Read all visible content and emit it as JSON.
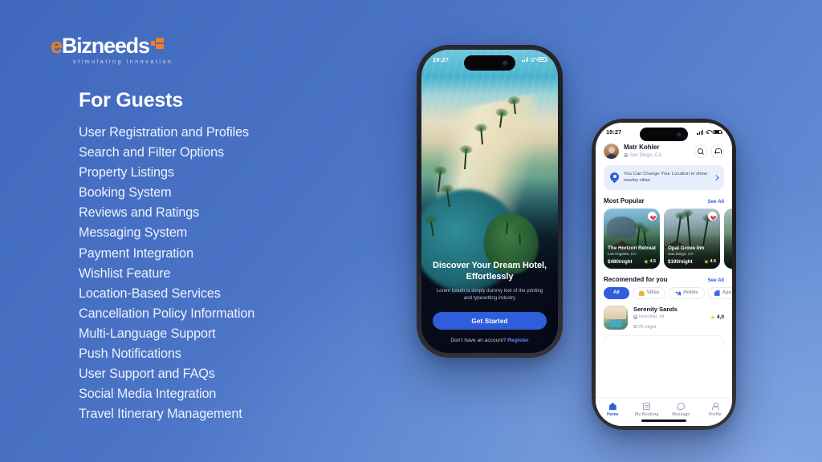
{
  "brand": {
    "name_prefix": "e",
    "name_rest": "Bizneeds",
    "tagline": "stimulating innovation"
  },
  "left_panel": {
    "heading": "For Guests",
    "features": [
      "User Registration and Profiles",
      "Search and Filter Options",
      "Property Listings",
      "Booking System",
      "Reviews and Ratings",
      "Messaging System",
      "Payment Integration",
      "Wishlist Feature",
      "Location-Based Services",
      "Cancellation Policy Information",
      "Multi-Language Support",
      "Push Notifications",
      "User Support and FAQs",
      "Social Media Integration",
      "Travel Itinerary Management"
    ]
  },
  "phone_onboarding": {
    "status_time": "19:27",
    "title": "Discover Your Dream Hotel, Effortlessly",
    "subtitle": "Lorem Ipsum is simply dummy text of the printing and typesetting industry",
    "cta_label": "Get Started",
    "footer_text": "Don't have an account?",
    "footer_link": "Register"
  },
  "phone_home": {
    "status_time": "19:27",
    "user_name": "Matr Kohler",
    "user_location": "San Diego, CA",
    "banner_text": "You Can Change Your Location to show nearby villas",
    "sections": {
      "popular_title": "Most Popular",
      "popular_link": "See All",
      "recommended_title": "Recomended for you",
      "recommended_link": "See All"
    },
    "popular_cards": [
      {
        "name": "The Horizon Retreat",
        "location": "Los Angeles, CA",
        "price": "$480/night",
        "rating": "4.5"
      },
      {
        "name": "Opal Grove Inn",
        "location": "San Diego, CA",
        "price": "$190/night",
        "rating": "4.5"
      }
    ],
    "filter_chips": [
      {
        "label": "All",
        "icon": "all-icon"
      },
      {
        "label": "Villas",
        "icon": "villa-icon"
      },
      {
        "label": "Hotels",
        "icon": "hotel-icon"
      },
      {
        "label": "Apa",
        "icon": "apartment-icon"
      }
    ],
    "recommended_listing": {
      "name": "Serenity Sands",
      "location": "Honolulu, HI",
      "price": "$270",
      "price_unit": "/night",
      "rating": "4,0"
    },
    "nav_items": [
      {
        "label": "Home",
        "icon": "home-icon"
      },
      {
        "label": "My Booking",
        "icon": "booking-icon"
      },
      {
        "label": "Message",
        "icon": "message-icon"
      },
      {
        "label": "Profile",
        "icon": "profile-icon"
      }
    ]
  },
  "colors": {
    "background_start": "#4069bd",
    "background_end": "#6b93d8",
    "accent_blue": "#2f5ddb",
    "brand_orange": "#ef7f1f",
    "star_yellow": "#f5c33b",
    "heart_red": "#ee3b4e"
  }
}
